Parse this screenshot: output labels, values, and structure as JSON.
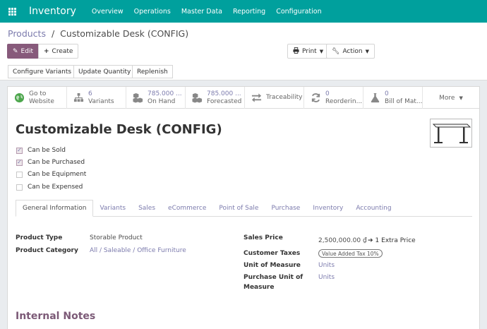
{
  "app": {
    "title": "Inventory",
    "menu": [
      "Overview",
      "Operations",
      "Master Data",
      "Reporting",
      "Configuration"
    ]
  },
  "breadcrumb": {
    "parent": "Products",
    "separator": "/",
    "current": "Customizable Desk (CONFIG)"
  },
  "toolbar": {
    "edit_label": "Edit",
    "create_label": "Create",
    "print_label": "Print",
    "action_label": "Action"
  },
  "header_buttons": [
    "Configure Variants",
    "Update Quantity",
    "Replenish"
  ],
  "smart_buttons": {
    "website": {
      "line1": "Go to",
      "line2": "Website"
    },
    "variants": {
      "value": "6",
      "label": "Variants"
    },
    "on_hand": {
      "value": "785.000 ...",
      "label": "On Hand"
    },
    "forecasted": {
      "value": "785.000 ...",
      "label": "Forecasted"
    },
    "traceability": {
      "label": "Traceability"
    },
    "reordering": {
      "value": "0",
      "label": "Reorderin..."
    },
    "bom": {
      "value": "0",
      "label": "Bill of Mat..."
    },
    "more": {
      "label": "More"
    }
  },
  "product": {
    "name": "Customizable Desk (CONFIG)",
    "flags": [
      {
        "label": "Can be Sold",
        "checked": true
      },
      {
        "label": "Can be Purchased",
        "checked": true
      },
      {
        "label": "Can be Equipment",
        "checked": false
      },
      {
        "label": "Can be Expensed",
        "checked": false
      }
    ]
  },
  "tabs": [
    "General Information",
    "Variants",
    "Sales",
    "eCommerce",
    "Point of Sale",
    "Purchase",
    "Inventory",
    "Accounting"
  ],
  "general": {
    "product_type_label": "Product Type",
    "product_type": "Storable Product",
    "category_label": "Product Category",
    "category": "All / Saleable / Office Furniture",
    "sales_price_label": "Sales Price",
    "sales_price": "2,500,000.00 ₫",
    "extra_price": "1 Extra Price",
    "taxes_label": "Customer Taxes",
    "tax_badge": "Value Added Tax 10%",
    "uom_label": "Unit of Measure",
    "uom": "Units",
    "purchase_uom_label_1": "Purchase Unit of",
    "purchase_uom_label_2": "Measure",
    "purchase_uom": "Units"
  },
  "notes": {
    "title": "Internal Notes"
  },
  "colors": {
    "brand": "#00a09d",
    "primary": "#875a7b",
    "link": "#7c7bad"
  }
}
